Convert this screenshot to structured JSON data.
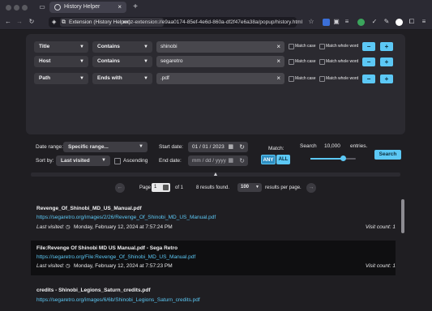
{
  "browser": {
    "tab_title": "History Helper",
    "new_tab_symbol": "+",
    "url_label": "Extension (History Helper)",
    "url": "moz-extension://e9aa0174-85ef-4e6d-860a-df2f47e6a38a/popup/history.html"
  },
  "filters": [
    {
      "field": "Title",
      "op": "Contains",
      "value": "shinobi"
    },
    {
      "field": "Host",
      "op": "Contains",
      "value": "segaretro"
    },
    {
      "field": "Path",
      "op": "Ends with",
      "value": ".pdf"
    }
  ],
  "filter_labels": {
    "match_case": "Match case",
    "match_whole_word": "Match whole word",
    "remove": "−",
    "add": "+"
  },
  "controls": {
    "date_range_label": "Date range:",
    "date_range_value": "Specific range...",
    "sort_by_label": "Sort by:",
    "sort_by_value": "Last visited",
    "ascending_label": "Ascending",
    "start_date_label": "Start date:",
    "start_date_value": "01 / 01 / 2023",
    "end_date_label": "End date:",
    "end_date_value": "mm / dd / yyyy",
    "match_label": "Match:",
    "match_any": "ANY",
    "match_all": "ALL",
    "search_label": "Search",
    "search_count": "10,000",
    "entries_label": "entries.",
    "search_button": "Search",
    "search_slider_fraction": 0.72
  },
  "pagination": {
    "page_label": "Page",
    "page_value": "1",
    "of_label": "of 1",
    "results_found": "8 results found.",
    "per_page_value": "100",
    "per_page_label": "results per page."
  },
  "results": [
    {
      "title": "Revenge_Of_Shinobi_MD_US_Manual.pdf",
      "url": "https://segaretro.org/images/2/26/Revenge_Of_Shinobi_MD_US_Manual.pdf",
      "last_visited_label": "Last visited:",
      "date": "Monday, February 12, 2024 at 7:57:24 PM",
      "visit_count": "Visit count: 1"
    },
    {
      "title": "File:Revenge Of Shinobi MD US Manual.pdf - Sega Retro",
      "url": "https://segaretro.org/File:Revenge_Of_Shinobi_MD_US_Manual.pdf",
      "last_visited_label": "Last visited:",
      "date": "Monday, February 12, 2024 at 7:57:23 PM",
      "visit_count": "Visit count: 1"
    },
    {
      "title": "credits - Shinobi_Legions_Saturn_credits.pdf",
      "url": "https://segaretro.org/images/6/6b/Shinobi_Legions_Saturn_credits.pdf",
      "last_visited_label": "",
      "date": "",
      "visit_count": ""
    }
  ],
  "colors": {
    "accent": "#5cc8f5",
    "background": "#1f1e22",
    "panel": "#2b2a30"
  }
}
